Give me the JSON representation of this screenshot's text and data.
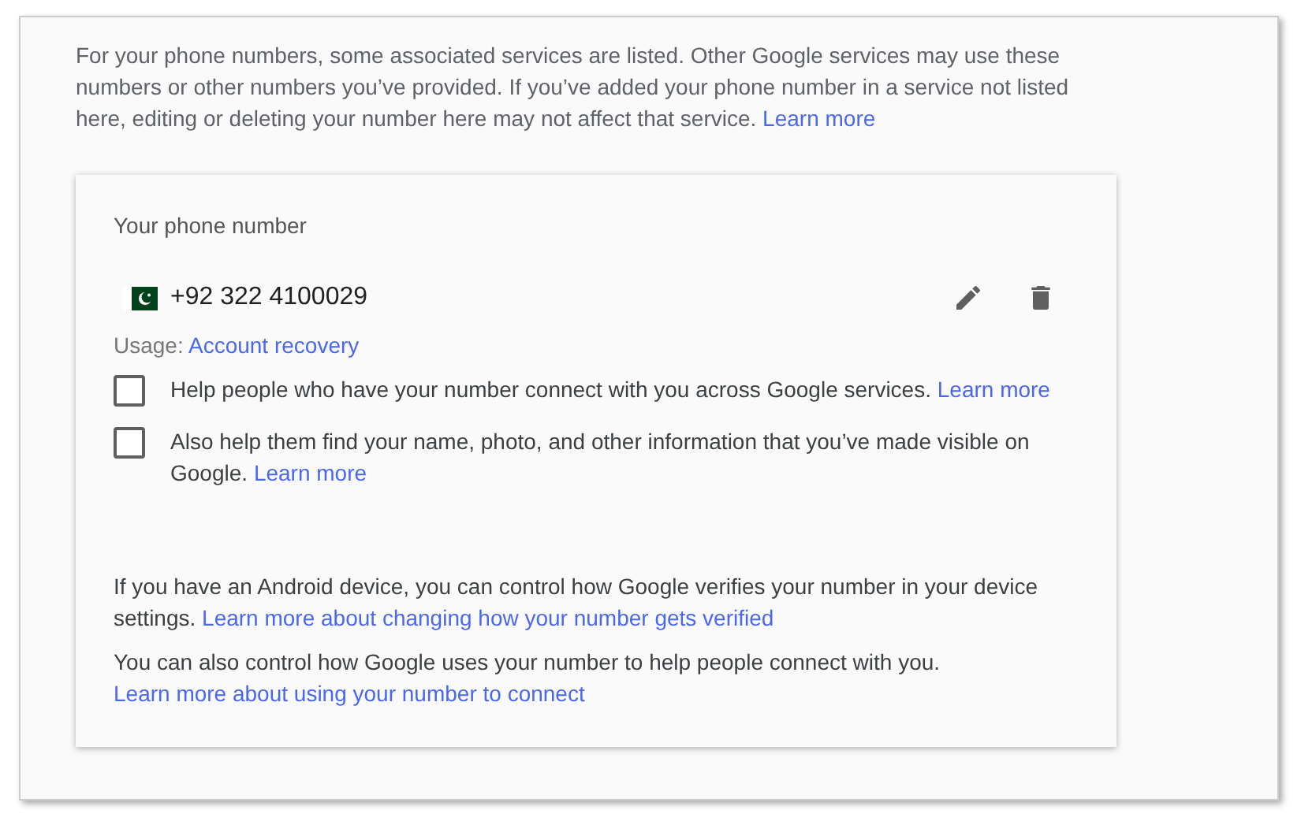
{
  "intro": {
    "text": "For your phone numbers, some associated services are listed. Other Google services may use these numbers or other numbers you’ve provided. If you’ve added your phone number in a service not listed here, editing or deleting your number here may not affect that service.",
    "link": "Learn more"
  },
  "card": {
    "title": "Your phone number",
    "phone": {
      "number": "+92 322 4100029"
    },
    "usage": {
      "label": "Usage:",
      "link": "Account recovery"
    },
    "options": [
      {
        "text": "Help people who have your number connect with you across Google services.",
        "link": "Learn more",
        "checked": false
      },
      {
        "text": "Also help them find your name, photo, and other information that you’ve made visible on Google.",
        "link": "Learn more",
        "checked": false
      }
    ],
    "notes": [
      {
        "text": "If you have an Android device, you can control how Google verifies your number in your device settings.",
        "link": "Learn more about changing how your number gets verified"
      },
      {
        "text": "You can also control how Google uses your number to help people connect with you.",
        "link": "Learn more about using your number to connect"
      }
    ]
  }
}
